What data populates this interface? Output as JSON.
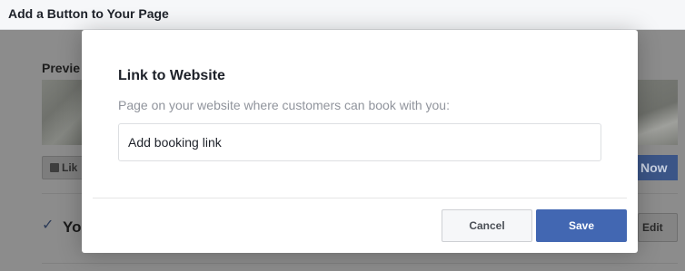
{
  "header": {
    "title": "Add a Button to Your Page"
  },
  "background": {
    "preview_label": "Previe",
    "like_label": "Lik",
    "now_label": "Now",
    "row_text": "Yo",
    "edit_label": "Edit"
  },
  "modal": {
    "title": "Link to Website",
    "description": "Page on your website where customers can book with you:",
    "input": {
      "value": "Add booking link",
      "placeholder": ""
    },
    "cancel_label": "Cancel",
    "save_label": "Save"
  },
  "colors": {
    "primary": "#4267b2",
    "overlay": "#8c8c8c"
  }
}
